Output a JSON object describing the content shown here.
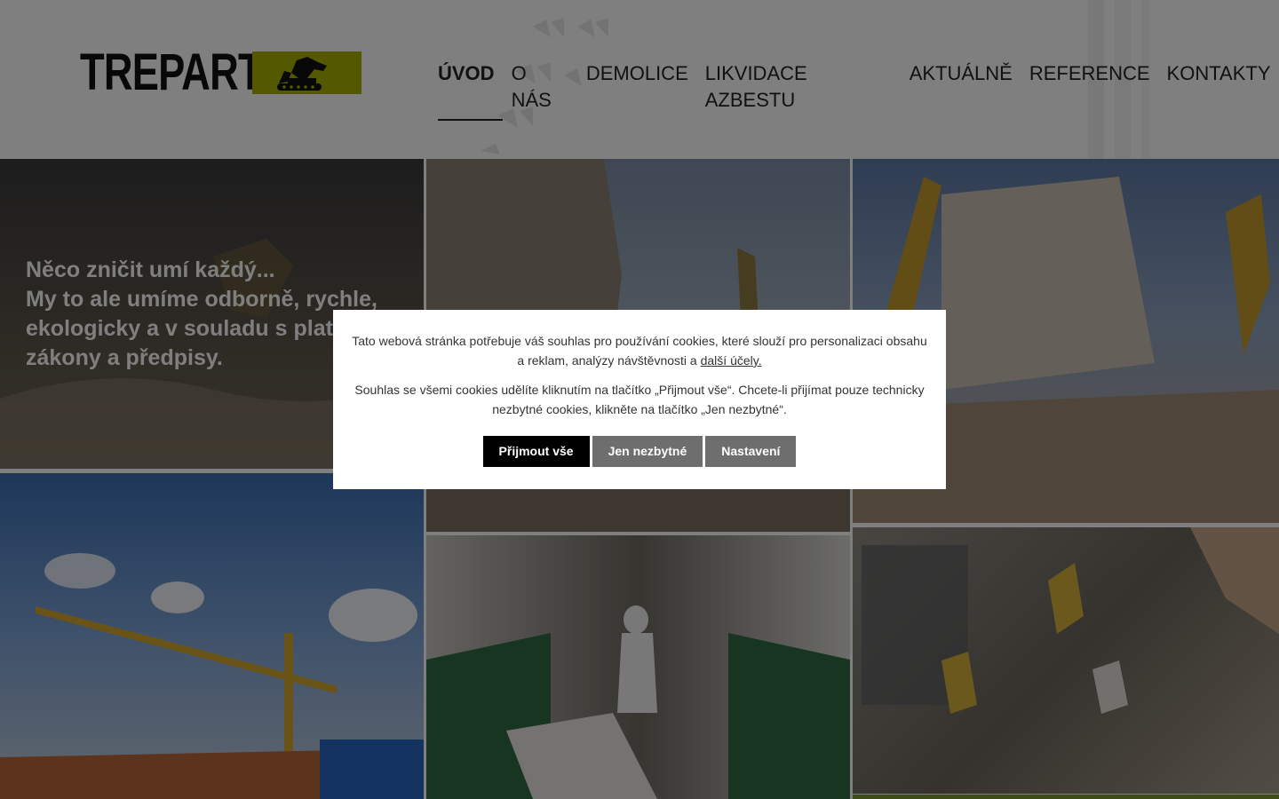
{
  "brand": {
    "name": "TREPART"
  },
  "nav": {
    "items": [
      {
        "label": "ÚVOD",
        "active": true
      },
      {
        "label": "O NÁS"
      },
      {
        "label": "DEMOLICE"
      },
      {
        "label": "LIKVIDACE AZBESTU"
      },
      {
        "label": "AKTUÁLNĚ"
      },
      {
        "label": "REFERENCE"
      },
      {
        "label": "KONTAKTY"
      }
    ]
  },
  "hero": {
    "line1": "Něco zničit umí každý...",
    "line2": "My to ale umíme odborně, rychle, ekologicky a v souladu s platnými zákony a předpisy."
  },
  "cookie": {
    "text1": "Tato webová stránka potřebuje váš souhlas pro používání cookies, které slouží pro personalizaci obsahu a reklam, analýzy návštěvnosti a",
    "link": "další účely.",
    "text2": "Souhlas se všemi cookies udělíte kliknutím na tlačítko „Přijmout vše“. Chcete-li přijímat pouze technicky nezbytné cookies, klikněte na tlačítko „Jen nezbytné“.",
    "accept": "Přijmout vše",
    "necessary": "Jen nezbytné",
    "settings": "Nastavení"
  },
  "colors": {
    "brand": "#a9b000",
    "overlay": "rgba(0,0,0,0.5)"
  },
  "icons": [
    "excavator-logo-icon",
    "footprint-decoration-icon",
    "tire-track-decoration-icon"
  ]
}
